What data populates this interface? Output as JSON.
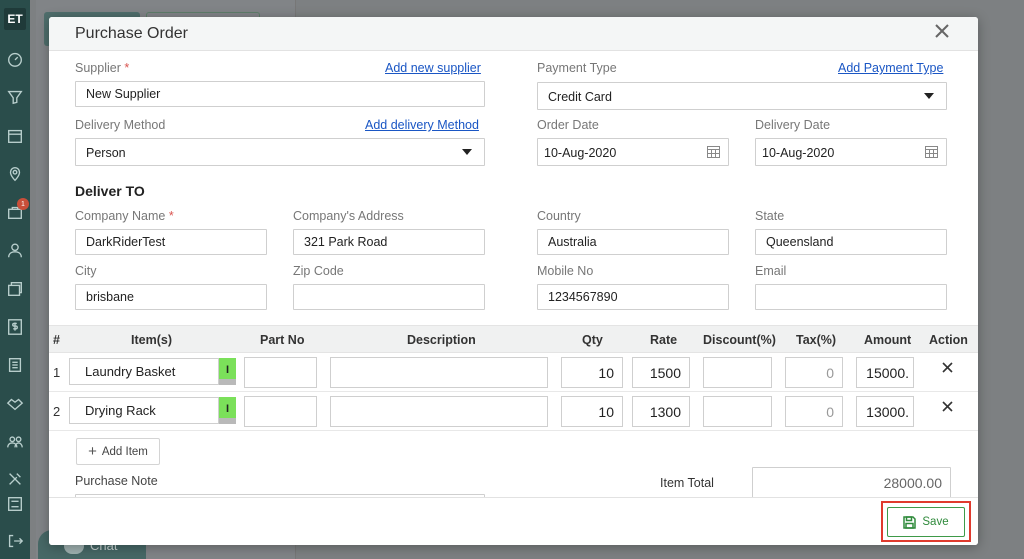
{
  "app": {
    "logo": "ET"
  },
  "background": {
    "chat_label": "Chat"
  },
  "sidebar": {
    "badge_count": "1",
    "icons": [
      "dashboard-icon",
      "funnel-icon",
      "calendar-icon",
      "location-icon",
      "briefcase-icon",
      "user-icon",
      "layers-icon",
      "dollar-icon",
      "document-icon",
      "handshake-icon",
      "team-icon",
      "tools-icon",
      "sliders-icon",
      "logout-icon"
    ]
  },
  "modal": {
    "title": "Purchase Order",
    "supplier": {
      "label": "Supplier",
      "required": "*",
      "add_link": "Add new supplier",
      "value": "New Supplier"
    },
    "payment": {
      "label": "Payment Type",
      "add_link": "Add Payment Type",
      "value": "Credit Card"
    },
    "delivery_method": {
      "label": "Delivery Method",
      "add_link": "Add delivery Method",
      "value": "Person"
    },
    "order_date": {
      "label": "Order Date",
      "value": "10-Aug-2020"
    },
    "delivery_date": {
      "label": "Delivery Date",
      "value": "10-Aug-2020"
    },
    "deliver_to": {
      "title": "Deliver TO",
      "company_name": {
        "label": "Company Name",
        "required": "*",
        "value": "DarkRiderTest"
      },
      "company_address": {
        "label": "Company's Address",
        "value": "321 Park Road"
      },
      "country": {
        "label": "Country",
        "value": "Australia"
      },
      "state": {
        "label": "State",
        "value": "Queensland"
      },
      "city": {
        "label": "City",
        "value": "brisbane"
      },
      "zip": {
        "label": "Zip Code",
        "value": ""
      },
      "mobile": {
        "label": "Mobile No",
        "value": "1234567890"
      },
      "email": {
        "label": "Email",
        "value": ""
      }
    },
    "table": {
      "headers": {
        "num": "#",
        "item": "Item(s)",
        "part": "Part No",
        "desc": "Description",
        "qty": "Qty",
        "rate": "Rate",
        "discount": "Discount(%)",
        "tax": "Tax(%)",
        "amount": "Amount",
        "action": "Action"
      },
      "rows": [
        {
          "num": "1",
          "item": "Laundry Basket",
          "inv": "I",
          "part": "",
          "desc": "",
          "qty": "10",
          "rate": "1500",
          "discount": "",
          "tax": "0",
          "amount": "15000."
        },
        {
          "num": "2",
          "item": "Drying Rack",
          "inv": "I",
          "part": "",
          "desc": "",
          "qty": "10",
          "rate": "1300",
          "discount": "",
          "tax": "0",
          "amount": "13000."
        }
      ]
    },
    "add_item_label": "Add Item",
    "purchase_note_label": "Purchase Note",
    "item_total": {
      "label": "Item Total",
      "value": "28000.00"
    },
    "save_label": "Save"
  }
}
